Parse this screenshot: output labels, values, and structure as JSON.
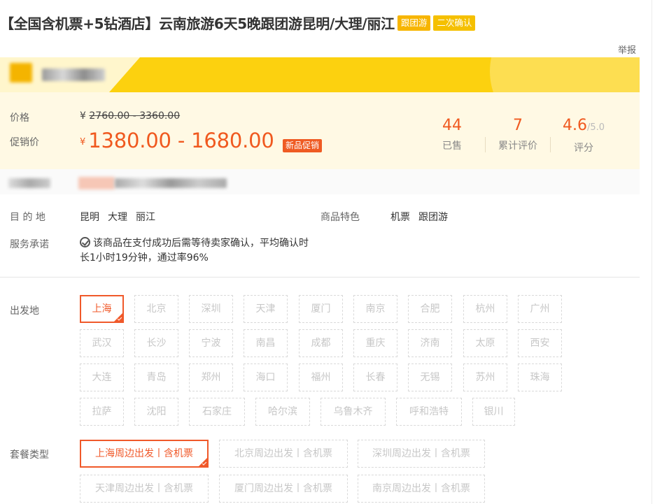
{
  "product": {
    "title": "【全国含机票+5钻酒店】云南旅游6天5晚跟团游昆明/大理/丽江",
    "tags": [
      "跟团游",
      "二次确认"
    ],
    "report_label": "举报"
  },
  "price": {
    "price_label": "价格",
    "promo_label": "促销价",
    "currency": "¥",
    "original_range": "2760.00 - 3360.00",
    "promo_range": "1380.00 - 1680.00",
    "promo_badge": "新品促销"
  },
  "stats": [
    {
      "value": "44",
      "label": "已售"
    },
    {
      "value": "7",
      "label": "累计评价"
    },
    {
      "value": "4.6",
      "suffix": "/5.0",
      "label": "评分"
    }
  ],
  "details": {
    "destination_label": "目 的 地",
    "destinations": [
      "昆明",
      "大理",
      "丽江"
    ],
    "feature_label": "商品特色",
    "features": [
      "机票",
      "跟团游"
    ],
    "service_label": "服务承诺",
    "service_text": "该商品在支付成功后需等待卖家确认，平均确认时长1小时19分钟，通过率96%"
  },
  "departure": {
    "label": "出发地",
    "selected": "上海",
    "options": [
      "上海",
      "北京",
      "深圳",
      "天津",
      "厦门",
      "南京",
      "合肥",
      "杭州",
      "广州",
      "武汉",
      "长沙",
      "宁波",
      "南昌",
      "成都",
      "重庆",
      "济南",
      "太原",
      "西安",
      "大连",
      "青岛",
      "郑州",
      "海口",
      "福州",
      "长春",
      "无锡",
      "苏州",
      "珠海",
      "拉萨",
      "沈阳",
      "石家庄",
      "哈尔滨",
      "乌鲁木齐",
      "呼和浩特",
      "银川"
    ]
  },
  "package": {
    "label": "套餐类型",
    "selected": "上海周边出发丨含机票",
    "options": [
      "上海周边出发丨含机票",
      "北京周边出发丨含机票",
      "深圳周边出发丨含机票",
      "天津周边出发丨含机票",
      "厦门周边出发丨含机票",
      "南京周边出发丨含机票"
    ]
  },
  "colors": {
    "accent": "#f0591f",
    "tag": "#f7b500",
    "banner": "#fcd10f"
  }
}
